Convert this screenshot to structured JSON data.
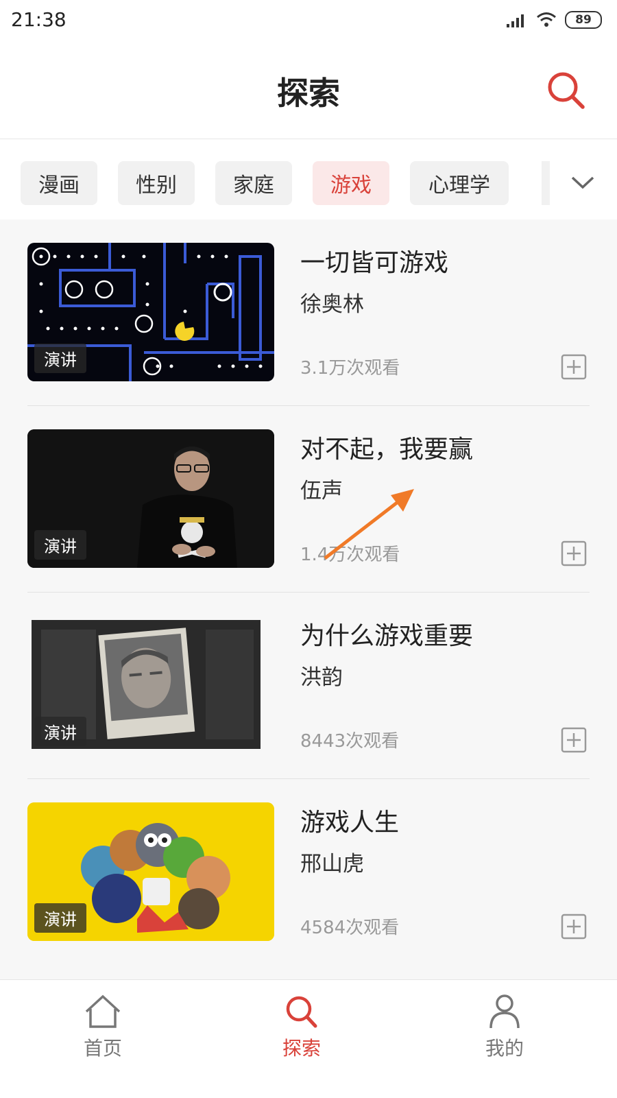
{
  "status_bar": {
    "time": "21:38",
    "battery": "89"
  },
  "header": {
    "title": "探索"
  },
  "tabs": [
    {
      "label": "漫画",
      "active": false
    },
    {
      "label": "性别",
      "active": false
    },
    {
      "label": "家庭",
      "active": false
    },
    {
      "label": "游戏",
      "active": true
    },
    {
      "label": "心理学",
      "active": false
    }
  ],
  "videos": [
    {
      "title": "一切皆可游戏",
      "speaker": "徐奥林",
      "views": "3.1万次观看",
      "badge": "演讲"
    },
    {
      "title": "对不起，我要赢",
      "speaker": "伍声",
      "views": "1.4万次观看",
      "badge": "演讲"
    },
    {
      "title": "为什么游戏重要",
      "speaker": "洪韵",
      "views": "8443次观看",
      "badge": "演讲"
    },
    {
      "title": "游戏人生",
      "speaker": "邢山虎",
      "views": "4584次观看",
      "badge": "演讲"
    }
  ],
  "bottom_nav": [
    {
      "label": "首页",
      "icon": "home-icon",
      "active": false
    },
    {
      "label": "探索",
      "icon": "search-icon",
      "active": true
    },
    {
      "label": "我的",
      "icon": "user-icon",
      "active": false
    }
  ],
  "colors": {
    "accent": "#d9423a",
    "background": "#f7f7f7"
  }
}
